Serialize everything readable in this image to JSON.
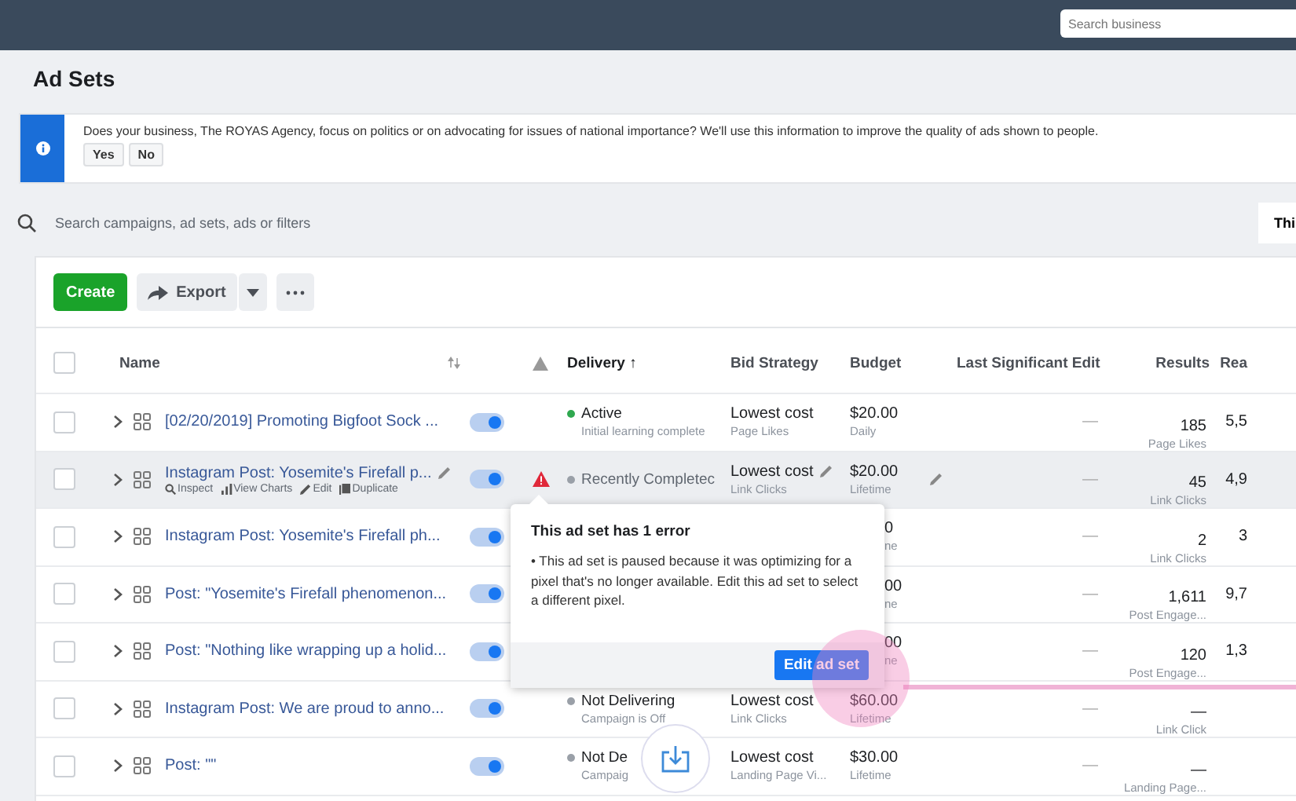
{
  "top_bar": {
    "search": {
      "placeholder": "Search business"
    }
  },
  "page": {
    "title": "Ad Sets"
  },
  "notice": {
    "text": "Does your business, The ROYAS Agency, focus on politics or on advocating for issues of national importance? We'll use this information to improve the quality of ads shown to people.",
    "buttons": [
      "Yes",
      "No"
    ]
  },
  "filter": {
    "placeholder": "Search campaigns, ad sets, ads or filters",
    "right_text": "Thi"
  },
  "toolbar": {
    "create": "Create",
    "export": "Export"
  },
  "table": {
    "header_checked": false,
    "columns": [
      "Name",
      "Delivery ↑",
      "Bid Strategy",
      "Budget",
      "Last Significant Edit",
      "Results",
      "Rea"
    ],
    "rows": [
      {
        "name": "[02/20/2019] Promoting Bigfoot Sock ...",
        "checked": false,
        "on": true,
        "highlighted": false,
        "error": false,
        "covered": false,
        "delivery": {
          "status": "Active",
          "detail": "Initial learning complete",
          "color": "#2fa84f"
        },
        "bid": {
          "text": "Lowest cost",
          "detail": "Page Likes"
        },
        "budget": {
          "text": "$20.00",
          "detail": "Daily"
        },
        "last_edit": "—",
        "results": {
          "value": "185",
          "detail": "Page Likes"
        },
        "reach": "5,5"
      },
      {
        "name": "Instagram Post: Yosemite's Firefall p...",
        "checked": false,
        "on": true,
        "highlighted": true,
        "error": true,
        "covered": false,
        "actions": [
          {
            "kind": "search",
            "label": "Inspect"
          },
          {
            "kind": "chart",
            "label": "View Charts"
          },
          {
            "kind": "edit",
            "label": "Edit"
          },
          {
            "kind": "copy",
            "label": "Duplicate"
          }
        ],
        "delivery": {
          "status": "Recently Completec",
          "color": "#9aa0a8"
        },
        "bid": {
          "text": "Lowest cost",
          "detail": "Link Clicks"
        },
        "budget": {
          "text": "$20.00",
          "detail": "Lifetime"
        },
        "last_edit": "—",
        "results": {
          "value": "45",
          "detail": "Link Clicks"
        },
        "reach": "4,9"
      },
      {
        "name": "Instagram Post: Yosemite's Firefall ph...",
        "checked": false,
        "on": true,
        "highlighted": false,
        "error": false,
        "covered": true,
        "budget": {
          "text": "0",
          "detail": "ne"
        },
        "last_edit": "—",
        "results": {
          "value": "2",
          "detail": "Link Clicks"
        },
        "reach": "3"
      },
      {
        "name": "Post: \"Yosemite's Firefall phenomenon...",
        "checked": false,
        "on": true,
        "highlighted": false,
        "error": false,
        "covered": true,
        "budget": {
          "text": "00",
          "detail": "ne"
        },
        "last_edit": "—",
        "results": {
          "value": "1,611",
          "detail": "Post Engage..."
        },
        "reach": "9,7"
      },
      {
        "name": "Post: \"Nothing like wrapping up a holid...",
        "checked": false,
        "on": true,
        "highlighted": false,
        "error": false,
        "covered": true,
        "budget": {
          "text": "00",
          "detail": "ne"
        },
        "last_edit": "—",
        "results": {
          "value": "120",
          "detail": "Post Engage..."
        },
        "reach": "1,3"
      },
      {
        "name": "Instagram Post: We are proud to anno...",
        "checked": false,
        "on": true,
        "highlighted": false,
        "error": false,
        "covered": false,
        "delivery": {
          "status": "Not Delivering",
          "detail": "Campaign is Off",
          "color": "#9aa0a8"
        },
        "bid": {
          "text": "Lowest cost",
          "detail": "Link Clicks"
        },
        "budget": {
          "text": "$60.00",
          "detail": "Lifetime"
        },
        "last_edit": "—",
        "results": {
          "value": "—",
          "detail": "Link Click"
        }
      },
      {
        "name": "Post: \"\"",
        "checked": false,
        "on": true,
        "highlighted": false,
        "error": false,
        "covered": false,
        "delivery": {
          "status": "Not De",
          "detail": "Campaig",
          "color": "#9aa0a8"
        },
        "bid": {
          "text": "Lowest cost",
          "detail": "Landing Page Vi..."
        },
        "budget": {
          "text": "$30.00",
          "detail": "Lifetime"
        },
        "last_edit": "—",
        "results": {
          "value": "—",
          "detail": "Landing Page..."
        }
      }
    ]
  },
  "popover": {
    "title": "This ad set has 1 error",
    "message": "• This ad set is paused because it was optimizing for a pixel that's no longer available. Edit this ad set to select a different pixel.",
    "button": "Edit ad set"
  }
}
